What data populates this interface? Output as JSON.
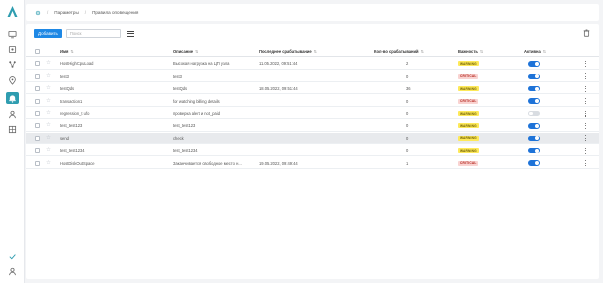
{
  "breadcrumb": {
    "home_icon": "gear-icon",
    "items": [
      "Параметры",
      "Правила оповещения"
    ]
  },
  "sidebar": {
    "logo": "brand-logo",
    "items": [
      {
        "icon": "monitor-icon",
        "active": false
      },
      {
        "icon": "shield-icon",
        "active": false
      },
      {
        "icon": "nodes-icon",
        "active": false
      },
      {
        "icon": "location-icon",
        "active": false
      },
      {
        "icon": "bell-icon",
        "active": true
      },
      {
        "icon": "user-icon",
        "active": false
      },
      {
        "icon": "grid-icon",
        "active": false
      }
    ],
    "bottom": [
      {
        "icon": "check-icon"
      },
      {
        "icon": "profile-icon"
      }
    ]
  },
  "toolbar": {
    "add_label": "Добавить",
    "search_placeholder": "Поиск"
  },
  "table": {
    "columns": {
      "name": "Имя",
      "description": "Описание",
      "last_triggered": "Последнее срабатывание",
      "count": "Кол-во срабатываний",
      "severity": "Важность",
      "active": "Активна"
    },
    "rows": [
      {
        "name": "HostHighCpuLoad",
        "description": "Высокая нагрузка на ЦП узла",
        "last": "11.05.2022, 09:51:44",
        "count": "2",
        "severity": "WARNING",
        "active": true
      },
      {
        "name": "test3",
        "description": "test3",
        "last": "",
        "count": "0",
        "severity": "CRITICAL",
        "active": true
      },
      {
        "name": "testQds",
        "description": "testQds",
        "last": "18.05.2022, 09:51:44",
        "count": "36",
        "severity": "WARNING",
        "active": true
      },
      {
        "name": "transaction1",
        "description": "for watching billing details",
        "last": "",
        "count": "0",
        "severity": "CRITICAL",
        "active": true
      },
      {
        "name": "regression_t ufo",
        "description": "проверка alert и not_paid",
        "last": "",
        "count": "0",
        "severity": "WARNING",
        "active": false
      },
      {
        "name": "test_test123",
        "description": "test_test123",
        "last": "",
        "count": "0",
        "severity": "WARNING",
        "active": true
      },
      {
        "name": "send",
        "description": "check",
        "last": "",
        "count": "0",
        "severity": "WARNING",
        "active": true
      },
      {
        "name": "test_test1234",
        "description": "test_test1234",
        "last": "",
        "count": "0",
        "severity": "WARNING",
        "active": true
      },
      {
        "name": "HostDiskOutSpace",
        "description": "Заканчивается свободное место н...",
        "last": "19.05.2022, 09:49:44",
        "count": "1",
        "severity": "CRITICAL",
        "active": true
      }
    ]
  },
  "colors": {
    "accent": "#1e88e5",
    "active_nav": "#2f9db0",
    "toggle_on": "#1e73d8",
    "warning": "#fde95a",
    "critical": "#f9d3d1"
  }
}
